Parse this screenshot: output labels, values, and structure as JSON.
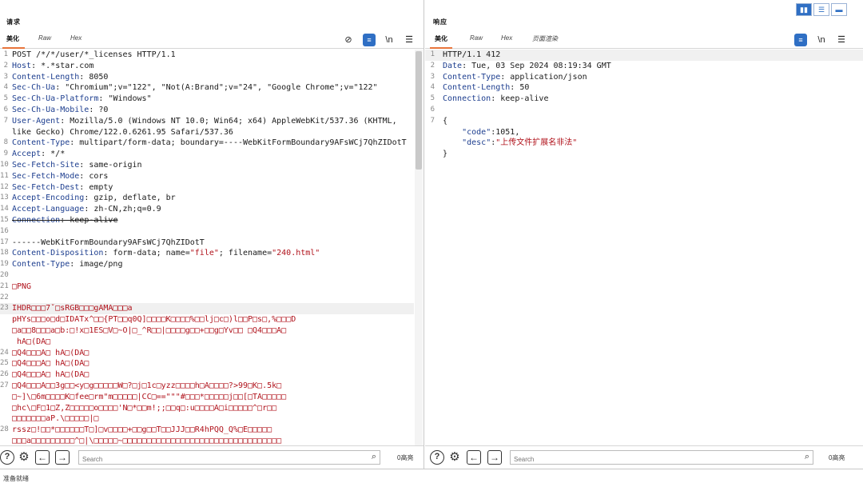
{
  "request": {
    "title": "请求",
    "tabs": [
      {
        "label": "美化",
        "active": true
      },
      {
        "label": "Raw",
        "active": false
      },
      {
        "label": "Hex",
        "active": false
      }
    ],
    "tools": {
      "newline_label": "\\n"
    },
    "lines": [
      {
        "n": "1",
        "k": "",
        "v": "POST /*/*/user/*_licenses HTTP/1.1"
      },
      {
        "n": "2",
        "k": "Host",
        "v": ": *.*star.com"
      },
      {
        "n": "3",
        "k": "Content-Length",
        "v": ": 8050"
      },
      {
        "n": "4",
        "k": "Sec-Ch-Ua",
        "v": ": \"Chromium\";v=\"122\", \"Not(A:Brand\";v=\"24\", \"Google Chrome\";v=\"122\""
      },
      {
        "n": "5",
        "k": "Sec-Ch-Ua-Platform",
        "v": ": \"Windows\""
      },
      {
        "n": "6",
        "k": "Sec-Ch-Ua-Mobile",
        "v": ": ?0"
      },
      {
        "n": "7",
        "k": "User-Agent",
        "v": ": Mozilla/5.0 (Windows NT 10.0; Win64; x64) AppleWebKit/537.36 (KHTML,"
      },
      {
        "n": "",
        "k": "",
        "v": "like Gecko) Chrome/122.0.6261.95 Safari/537.36"
      },
      {
        "n": "8",
        "k": "Content-Type",
        "v": ": multipart/form-data; boundary=----WebKitFormBoundary9AFsWCj7QhZIDotT"
      },
      {
        "n": "9",
        "k": "Accept",
        "v": ": */*"
      },
      {
        "n": "10",
        "k": "Sec-Fetch-Site",
        "v": ": same-origin"
      },
      {
        "n": "11",
        "k": "Sec-Fetch-Mode",
        "v": ": cors"
      },
      {
        "n": "12",
        "k": "Sec-Fetch-Dest",
        "v": ": empty"
      },
      {
        "n": "13",
        "k": "Accept-Encoding",
        "v": ": gzip, deflate, br"
      },
      {
        "n": "14",
        "k": "Accept-Language",
        "v": ": zh-CN,zh;q=0.9"
      },
      {
        "n": "15",
        "k": "Connection",
        "v": ": keep-alive",
        "strike": true
      },
      {
        "n": "16",
        "k": "",
        "v": ""
      },
      {
        "n": "17",
        "k": "",
        "v": "------WebKitFormBoundary9AFsWCj7QhZIDotT"
      },
      {
        "n": "18",
        "k": "Content-Disposition",
        "v": ": form-data; name=\"file\"; filename=\"240.html\""
      },
      {
        "n": "19",
        "k": "Content-Type",
        "v": ": image/png"
      },
      {
        "n": "20",
        "k": "",
        "v": ""
      },
      {
        "n": "21",
        "k": "",
        "v": "□PNG",
        "bin": true
      },
      {
        "n": "22",
        "k": "",
        "v": ""
      },
      {
        "n": "23",
        "k": "",
        "v": "IHDR□□□7ˇ□sRGB□□□gAMA□□□a",
        "bin": true,
        "hl": true
      },
      {
        "n": "",
        "k": "",
        "v": "pHYs□□□o□d□IDATx^□□{PT□□q0Q]□□□□K□□□□%□□lj□c□)l□□P□s□,%□□□D",
        "bin": true
      },
      {
        "n": "",
        "k": "",
        "v": "□a□□8□□□a□b:□!x□1ES□V□~O|□_^R□□|□□□□g□□+□□g□Yv□□ □Q4□□□A□",
        "bin": true
      },
      {
        "n": "",
        "k": "",
        "v": " hA□(DA□",
        "bin": true
      },
      {
        "n": "24",
        "k": "",
        "v": "□Q4□□□A□ hA□(DA□",
        "bin": true
      },
      {
        "n": "25",
        "k": "",
        "v": "□Q4□□□A□ hA□(DA□",
        "bin": true
      },
      {
        "n": "26",
        "k": "",
        "v": "□Q4□□□A□ hA□(DA□",
        "bin": true
      },
      {
        "n": "27",
        "k": "",
        "v": "□Q4□□□A□□3g□□<y□g□□□□□W□?□j□1c□yzz□□□□h□A□□□□?>99□K□.5k□",
        "bin": true
      },
      {
        "n": "",
        "k": "",
        "v": "□~]\\□6m□□□□K□fee□rm\"m□□□□□|CC□==\"\"\"#□□□*□□□□□j□□[□TA□□□□□",
        "bin": true
      },
      {
        "n": "",
        "k": "",
        "v": "□hc\\□F□1□Z,Z□□□□□o□□□□'N□*□□m!;;□□q□:u□□□□A□i□□□□□^□r□□",
        "bin": true
      },
      {
        "n": "",
        "k": "",
        "v": "□□□□□□□aP.\\□□□□□|□",
        "bin": true
      },
      {
        "n": "28",
        "k": "",
        "v": "rssz□!□□*□□□□□□T□]□v□□□□+□□g□□T□□JJJ□□R4hPQQ_Q%□E□□□□□",
        "bin": true
      },
      {
        "n": "",
        "k": "",
        "v": "□□□a□□□□□□□□□^□|\\□□□□□~□□□□□□□□□□□□□□□□□□□□□□□□□□□□□□□□□",
        "bin": true
      }
    ],
    "search_placeholder": "Search",
    "matches": "0高亮"
  },
  "response": {
    "title": "响应",
    "tabs": [
      {
        "label": "美化",
        "active": true
      },
      {
        "label": "Raw",
        "active": false
      },
      {
        "label": "Hex",
        "active": false
      },
      {
        "label": "页面渲染",
        "active": false
      }
    ],
    "tools": {
      "newline_label": "\\n"
    },
    "lines": [
      {
        "n": "1",
        "k": "",
        "v": "HTTP/1.1 412",
        "hl": true
      },
      {
        "n": "2",
        "k": "Date",
        "v": ": Tue, 03 Sep 2024 08:19:34 GMT"
      },
      {
        "n": "3",
        "k": "Content-Type",
        "v": ": application/json"
      },
      {
        "n": "4",
        "k": "Content-Length",
        "v": ": 50"
      },
      {
        "n": "5",
        "k": "Connection",
        "v": ": keep-alive"
      },
      {
        "n": "6",
        "k": "",
        "v": ""
      },
      {
        "n": "7",
        "k": "",
        "v": "{"
      },
      {
        "n": "",
        "k": "",
        "v": "    \"code\":1051,",
        "json": true
      },
      {
        "n": "",
        "k": "",
        "v": "    \"desc\":\"上传文件扩展名非法\"",
        "json": true
      },
      {
        "n": "",
        "k": "",
        "v": "}"
      }
    ],
    "search_placeholder": "Search",
    "matches": "0高亮"
  },
  "view_toggles": {
    "split": "▮▮",
    "horizontal": "☰",
    "single": "▬"
  },
  "status": {
    "text": "准备就绪"
  },
  "colors": {
    "accent": "#2f6fc4",
    "tab_underline": "#e8743b",
    "header_key": "#1d3e8f",
    "string": "#b0121b"
  }
}
